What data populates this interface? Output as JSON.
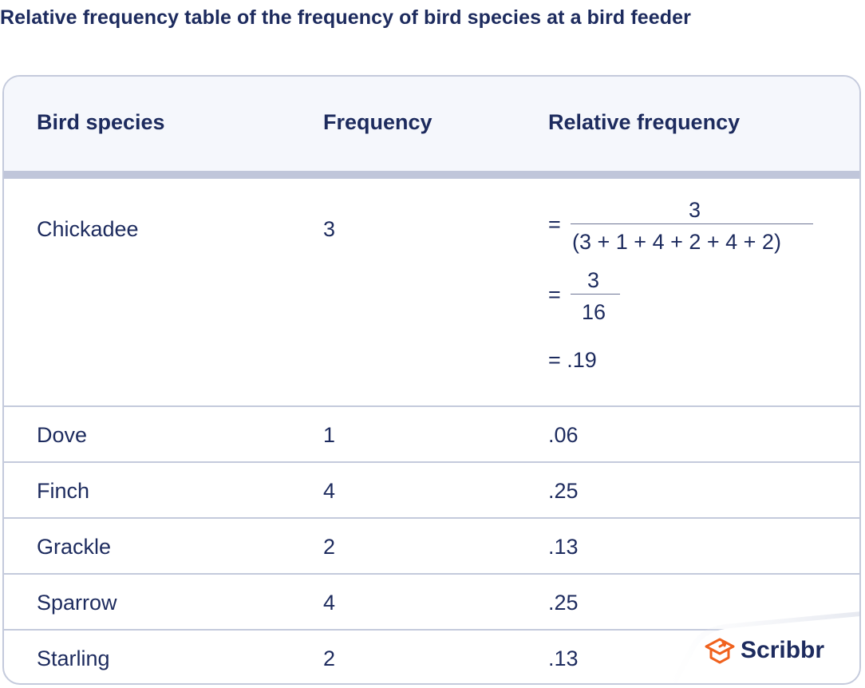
{
  "title": "Relative frequency table of the frequency of bird species at a bird feeder",
  "table": {
    "headers": [
      "Bird species",
      "Frequency",
      "Relative frequency"
    ],
    "chickadee": {
      "species": "Chickadee",
      "frequency": "3",
      "calc": {
        "eq": "=",
        "step1_numerator": "3",
        "step1_denominator": "(3 + 1 + 4 + 2 + 4 + 2)",
        "step2_numerator": "3",
        "step2_denominator": "16",
        "result": "= .19"
      }
    },
    "rows": [
      {
        "species": "Dove",
        "frequency": "1",
        "relative": ".06"
      },
      {
        "species": "Finch",
        "frequency": "4",
        "relative": ".25"
      },
      {
        "species": "Grackle",
        "frequency": "2",
        "relative": ".13"
      },
      {
        "species": "Sparrow",
        "frequency": "4",
        "relative": ".25"
      },
      {
        "species": "Starling",
        "frequency": "2",
        "relative": ".13"
      }
    ]
  },
  "brand": {
    "name": "Scribbr",
    "accent": "#f0621e",
    "text_color": "#1d2b5e"
  }
}
